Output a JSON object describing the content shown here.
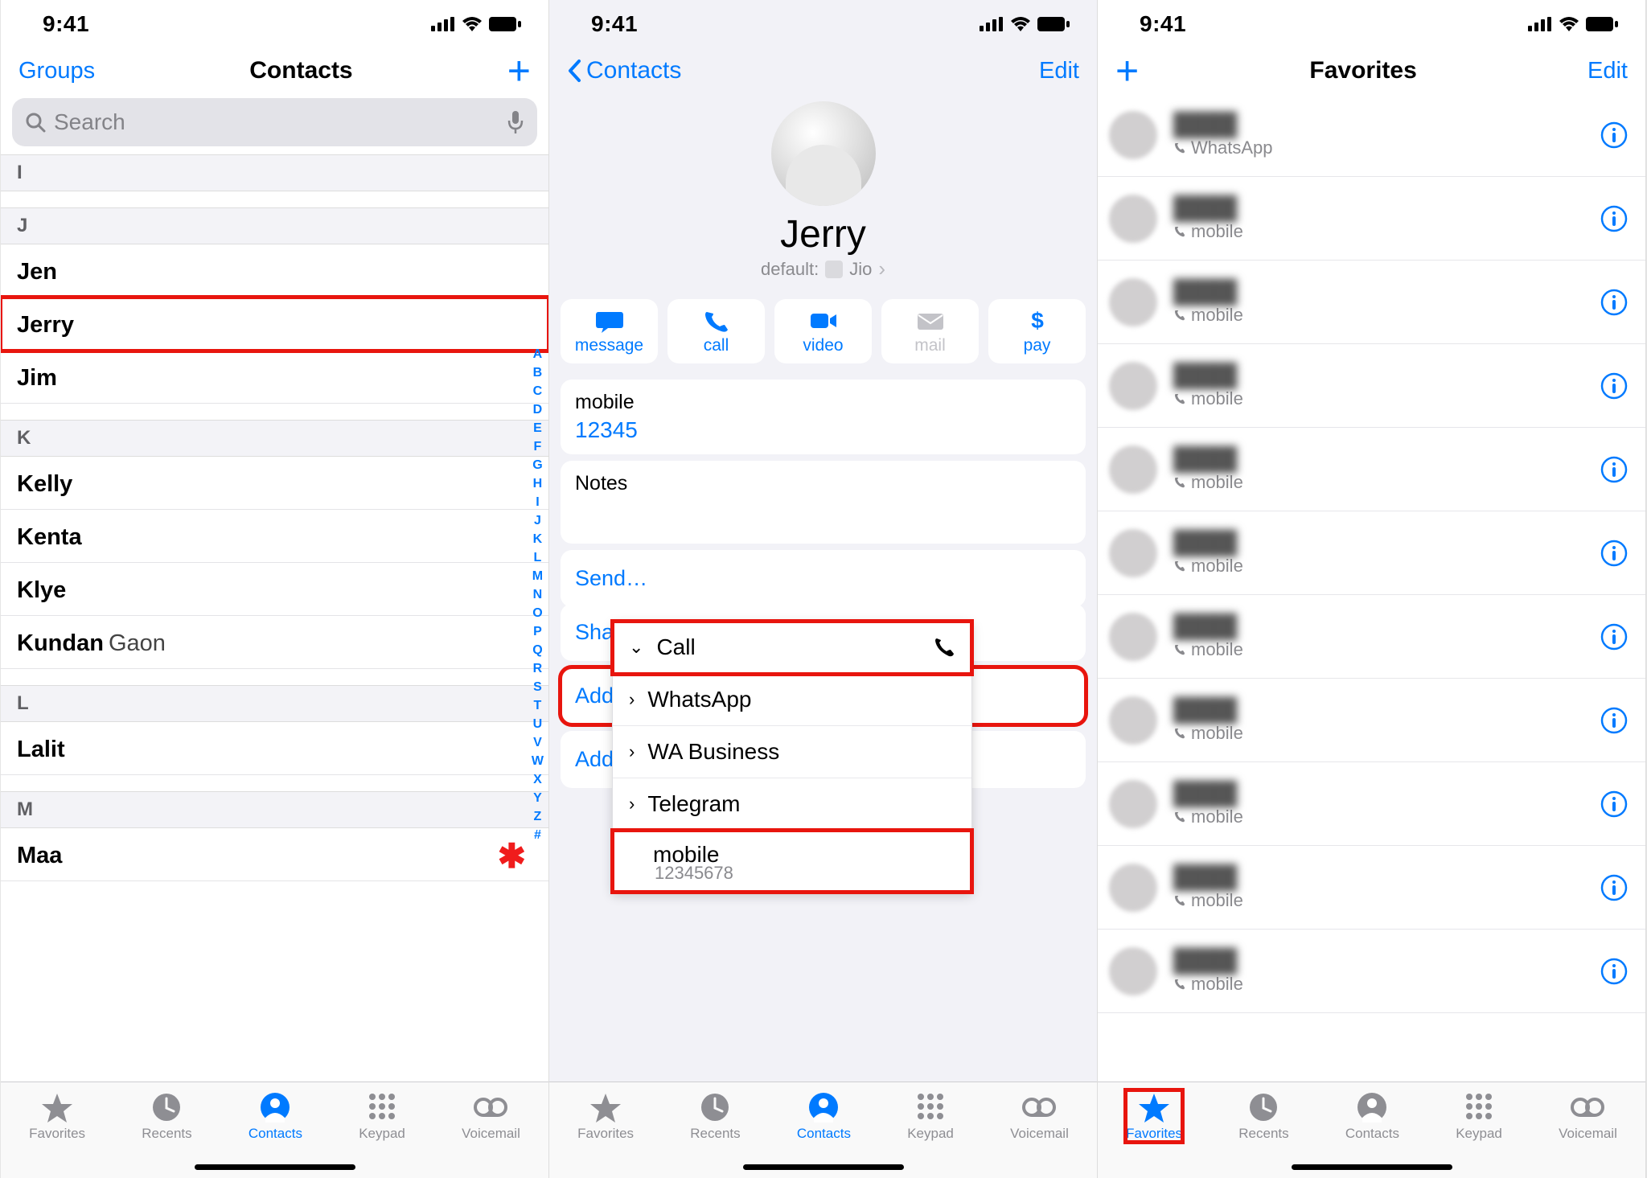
{
  "status": {
    "time": "9:41"
  },
  "screen1": {
    "nav": {
      "left": "Groups",
      "title": "Contacts"
    },
    "search": {
      "placeholder": "Search"
    },
    "sections": {
      "I": [],
      "J": [
        "Jen",
        "Jerry",
        "Jim"
      ],
      "K": [
        "Kelly",
        "Kenta",
        "Klye"
      ],
      "K_extra": {
        "first": "Kundan",
        "last": "Gaon"
      },
      "L": [
        "Lalit"
      ],
      "M": [
        "Maa"
      ]
    },
    "alpha": [
      "A",
      "B",
      "C",
      "D",
      "E",
      "F",
      "G",
      "H",
      "I",
      "J",
      "K",
      "L",
      "M",
      "N",
      "O",
      "P",
      "Q",
      "R",
      "S",
      "T",
      "U",
      "V",
      "W",
      "X",
      "Y",
      "Z",
      "#"
    ]
  },
  "screen2": {
    "nav": {
      "back": "Contacts",
      "right": "Edit"
    },
    "name": "Jerry",
    "default_label": "default:",
    "default_carrier": "Jio",
    "actions": {
      "message": "message",
      "call": "call",
      "video": "video",
      "mail": "mail",
      "pay": "pay"
    },
    "mobile_label": "mobile",
    "mobile_value": "12345",
    "notes_label": "Notes",
    "send_label": "Send",
    "share_label": "Share",
    "add_fav": "Add to Favorites",
    "add_emg": "Add to Emergency Contacts",
    "popup": {
      "call": "Call",
      "whatsapp": "WhatsApp",
      "wab": "WA Business",
      "telegram": "Telegram",
      "mob_label": "mobile",
      "mob_num": "12345678"
    }
  },
  "screen3": {
    "nav": {
      "title": "Favorites",
      "right": "Edit"
    },
    "rows": [
      {
        "sub": "WhatsApp"
      },
      {
        "sub": "mobile"
      },
      {
        "sub": "mobile"
      },
      {
        "sub": "mobile"
      },
      {
        "sub": "mobile"
      },
      {
        "sub": "mobile"
      },
      {
        "sub": "mobile"
      },
      {
        "sub": "mobile"
      },
      {
        "sub": "mobile"
      },
      {
        "sub": "mobile"
      },
      {
        "sub": "mobile"
      }
    ]
  },
  "tabbar": {
    "favorites": "Favorites",
    "recents": "Recents",
    "contacts": "Contacts",
    "keypad": "Keypad",
    "voicemail": "Voicemail"
  }
}
